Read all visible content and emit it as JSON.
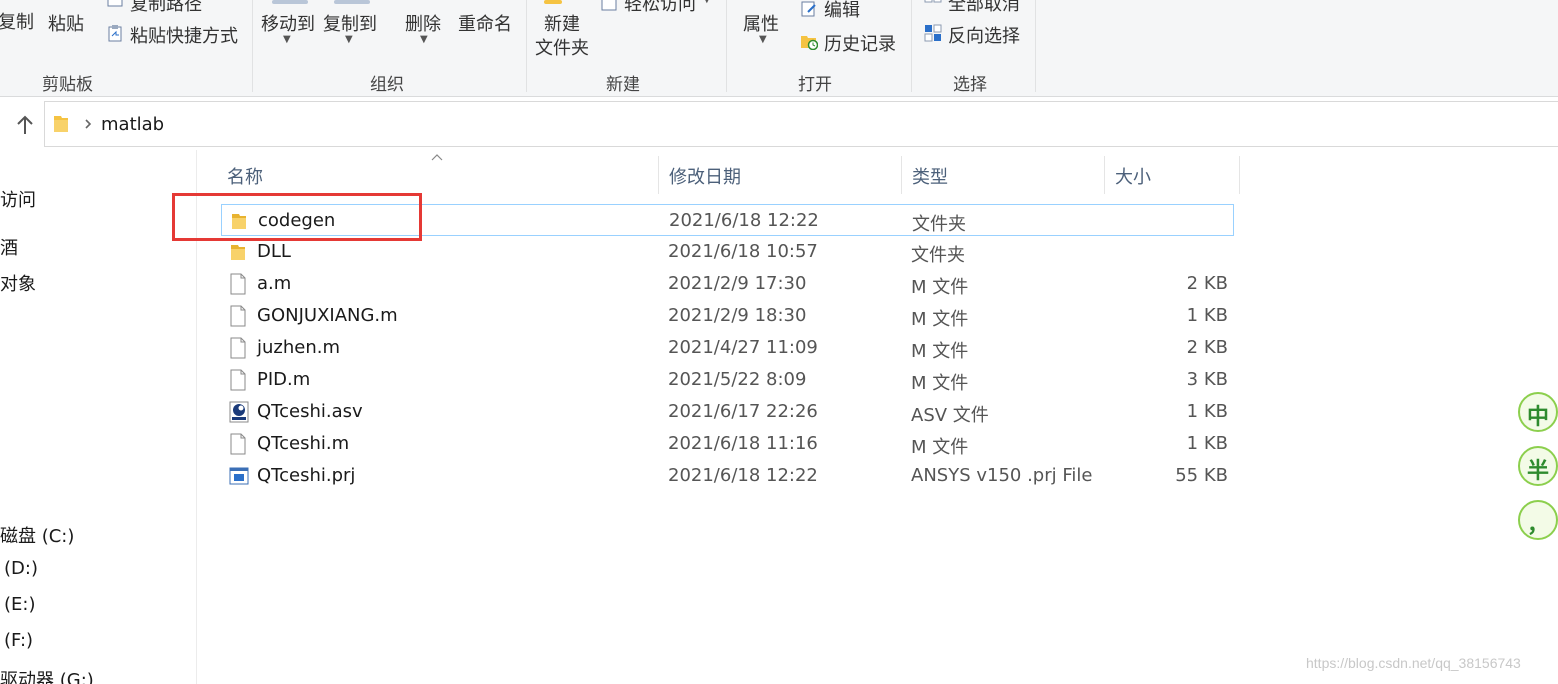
{
  "ribbon": {
    "clipboard": {
      "copy_label": "复制",
      "paste_label": "粘贴",
      "copy_path_label": "复制路径",
      "paste_shortcut_label": "粘贴快捷方式",
      "group_label": "剪贴板"
    },
    "organize": {
      "move_to_label": "移动到",
      "copy_to_label": "复制到",
      "delete_label": "删除",
      "rename_label": "重命名",
      "group_label": "组织"
    },
    "new": {
      "new_folder_line1": "新建",
      "new_folder_line2": "文件夹",
      "easy_access_label": "轻松访问",
      "group_label": "新建"
    },
    "open": {
      "properties_label": "属性",
      "edit_label": "编辑",
      "history_label": "历史记录",
      "group_label": "打开"
    },
    "select": {
      "select_none_label": "全部取消",
      "invert_label": "反向选择",
      "group_label": "选择"
    }
  },
  "address_bar": {
    "path": "matlab"
  },
  "nav_pane": {
    "items": [
      "访问",
      "酒",
      "对象",
      "磁盘 (C:)",
      "(D:)",
      "(E:)",
      "(F:)",
      "驱动器 (G:)"
    ]
  },
  "file_list": {
    "columns": {
      "name": "名称",
      "date": "修改日期",
      "type": "类型",
      "size": "大小"
    },
    "rows": [
      {
        "name": "codegen",
        "date": "2021/6/18 12:22",
        "type": "文件夹",
        "size": "",
        "icon": "folder-icon"
      },
      {
        "name": "DLL",
        "date": "2021/6/18 10:57",
        "type": "文件夹",
        "size": "",
        "icon": "folder-icon"
      },
      {
        "name": "a.m",
        "date": "2021/2/9 17:30",
        "type": "M 文件",
        "size": "2 KB",
        "icon": "file-icon"
      },
      {
        "name": "GONJUXIANG.m",
        "date": "2021/2/9 18:30",
        "type": "M 文件",
        "size": "1 KB",
        "icon": "file-icon"
      },
      {
        "name": "juzhen.m",
        "date": "2021/4/27 11:09",
        "type": "M 文件",
        "size": "2 KB",
        "icon": "file-icon"
      },
      {
        "name": "PID.m",
        "date": "2021/5/22 8:09",
        "type": "M 文件",
        "size": "3 KB",
        "icon": "file-icon"
      },
      {
        "name": "QTceshi.asv",
        "date": "2021/6/17 22:26",
        "type": "ASV 文件",
        "size": "1 KB",
        "icon": "asv-file-icon"
      },
      {
        "name": "QTceshi.m",
        "date": "2021/6/18 11:16",
        "type": "M 文件",
        "size": "1 KB",
        "icon": "file-icon"
      },
      {
        "name": "QTceshi.prj",
        "date": "2021/6/18 12:22",
        "type": "ANSYS v150 .prj File",
        "size": "55 KB",
        "icon": "prj-file-icon"
      }
    ]
  },
  "ime_widget": {
    "chars": [
      "中",
      "半",
      "，"
    ]
  },
  "watermark": "https://blog.csdn.net/qq_38156743",
  "colors": {
    "selection_border": "#99d1ff",
    "highlight_box": "#e53935",
    "folder": "#f5c342",
    "column_header": "#4c607a"
  }
}
